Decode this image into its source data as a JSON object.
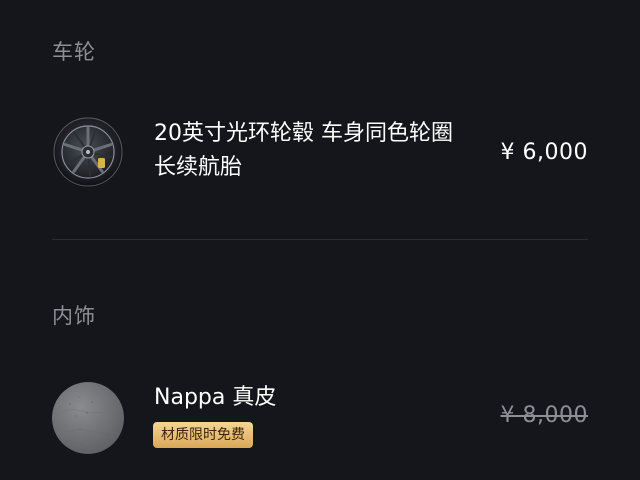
{
  "sections": {
    "wheels": {
      "title": "车轮",
      "option": {
        "name": "20英寸光环轮毂 车身同色轮圈 长续航胎",
        "price": "¥ 6,000"
      }
    },
    "interior": {
      "title": "内饰",
      "option": {
        "name": "Nappa 真皮",
        "badge": "材质限时免费",
        "original_price": "¥ 8,000"
      }
    }
  },
  "icons": {
    "wheel": "wheel-rim-icon",
    "interior": "leather-swatch-icon"
  },
  "colors": {
    "background": "#14161b",
    "muted_text": "#8c8f96",
    "badge_gold": "#e3b96f"
  }
}
